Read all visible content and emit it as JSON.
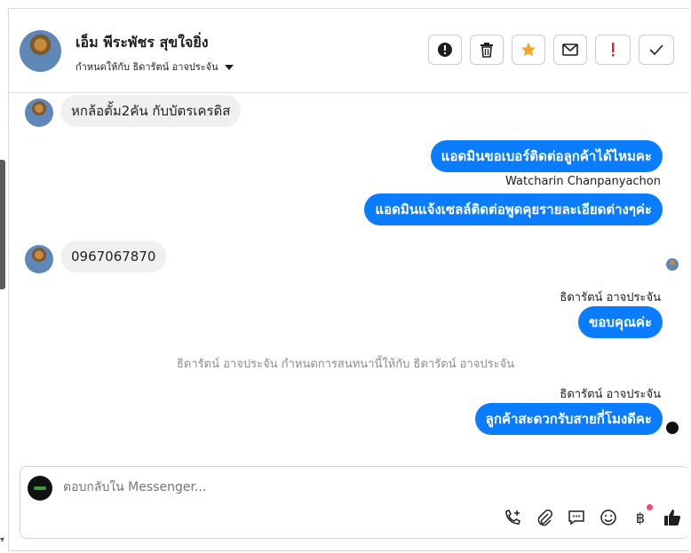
{
  "header": {
    "contact_name": "เอ็ม พีระพัชร สุขใจยิ่ง",
    "assigned_label": "กำหนดให้กับ ธิดารัตน์ อาจประจัน",
    "actions": [
      "info-icon",
      "trash-icon",
      "star-icon",
      "mail-icon",
      "exclamation-icon",
      "check-icon"
    ]
  },
  "messages": [
    {
      "dir": "in",
      "text": "หกล้อตั้ม2คัน กับบัตรเครดิส"
    },
    {
      "dir": "out",
      "text": "แอดมินขอเบอร์ติดต่อลูกค้าได้ไหมคะ"
    },
    {
      "dir": "sender",
      "text": "Watcharin Chanpanyachon"
    },
    {
      "dir": "out",
      "text": "แอดมินแจ้งเซลล์ติดต่อพูดคุยรายละเอียดต่างๆค่ะ"
    },
    {
      "dir": "in",
      "text": "0967067870"
    },
    {
      "dir": "sender",
      "text": "ธิดารัตน์ อาจประจัน"
    },
    {
      "dir": "out",
      "text": "ขอบคุณค่ะ"
    },
    {
      "dir": "system",
      "text": "ธิดารัตน์ อาจประจัน กำหนดการสนทนานี้ให้กับ ธิดารัตน์ อาจประจัน"
    },
    {
      "dir": "sender",
      "text": "ธิดารัตน์ อาจประจัน"
    },
    {
      "dir": "out",
      "text": "ลูกค้าสะดวกรับสายกี่โมงดีคะ"
    }
  ],
  "composer": {
    "placeholder": "ตอบกลับใน Messenger...",
    "tools": [
      "phone-plus-icon",
      "paperclip-icon",
      "chat-bubble-icon",
      "smiley-icon",
      "baht-icon",
      "thumbs-up-icon"
    ]
  },
  "colors": {
    "accent": "#0a7cff",
    "incoming": "#f0f0f0",
    "badge": "#f0506e",
    "star": "#f5a623",
    "alert": "#e02424"
  }
}
